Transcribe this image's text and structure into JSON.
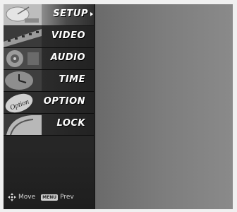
{
  "menu": {
    "items": [
      {
        "label": "SETUP",
        "icon": "satellite-dish-icon",
        "selected": true
      },
      {
        "label": "VIDEO",
        "icon": "film-reel-icon",
        "selected": false
      },
      {
        "label": "AUDIO",
        "icon": "speaker-icon",
        "selected": false
      },
      {
        "label": "TIME",
        "icon": "clock-icon",
        "selected": false
      },
      {
        "label": "OPTION",
        "icon": "option-badge-icon",
        "badge": "Option",
        "selected": false
      },
      {
        "label": "LOCK",
        "icon": "lock-icon",
        "selected": false
      }
    ]
  },
  "footer": {
    "move_label": "Move",
    "prev_label": "Prev",
    "menu_key": "MENU"
  }
}
